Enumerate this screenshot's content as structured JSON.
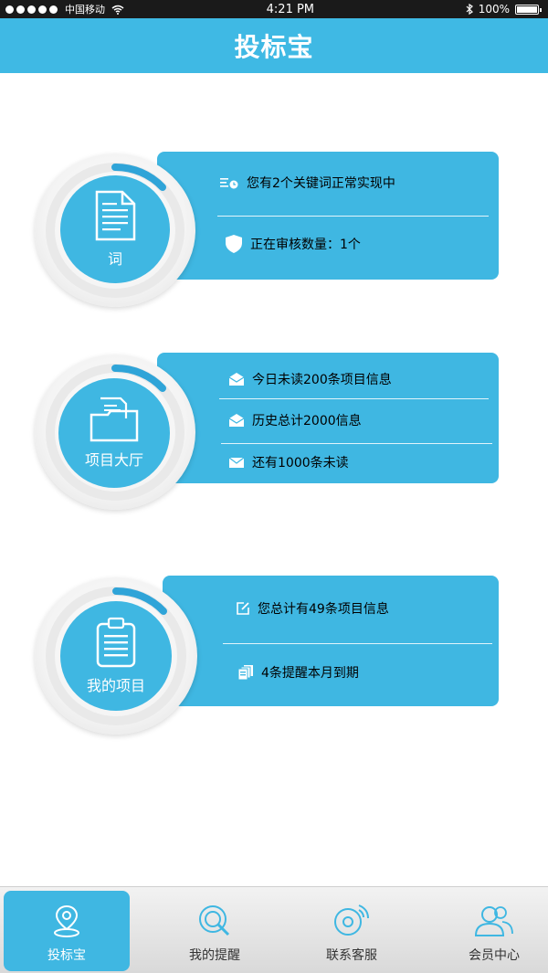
{
  "status_bar": {
    "carrier": "中国移动",
    "time": "4:21 PM",
    "battery": "100%"
  },
  "header": {
    "title": "投标宝"
  },
  "cards": [
    {
      "label": "词",
      "items": [
        {
          "icon": "list-clock-icon",
          "text": "您有2个关键词正常实现中"
        },
        {
          "icon": "shield-icon",
          "text": "正在审核数量：1个"
        }
      ]
    },
    {
      "label": "项目大厅",
      "items": [
        {
          "icon": "open-mail-icon",
          "text": "今日未读200条项目信息"
        },
        {
          "icon": "open-mail-icon",
          "text": "历史总计2000信息"
        },
        {
          "icon": "mail-icon",
          "text": "还有1000条未读"
        }
      ]
    },
    {
      "label": "我的项目",
      "items": [
        {
          "icon": "edit-icon",
          "text": "您总计有49条项目信息"
        },
        {
          "icon": "stack-icon",
          "text": "4条提醒本月到期"
        }
      ]
    }
  ],
  "bottom_nav": [
    {
      "label": "投标宝",
      "icon": "location-pin-icon",
      "active": true
    },
    {
      "label": "我的提醒",
      "icon": "search-reminder-icon",
      "active": false
    },
    {
      "label": "联系客服",
      "icon": "customer-service-icon",
      "active": false
    },
    {
      "label": "会员中心",
      "icon": "members-icon",
      "active": false
    }
  ],
  "colors": {
    "primary": "#3fb7e2",
    "status_bar": "#1a1a1a",
    "text_dark": "#333333"
  }
}
